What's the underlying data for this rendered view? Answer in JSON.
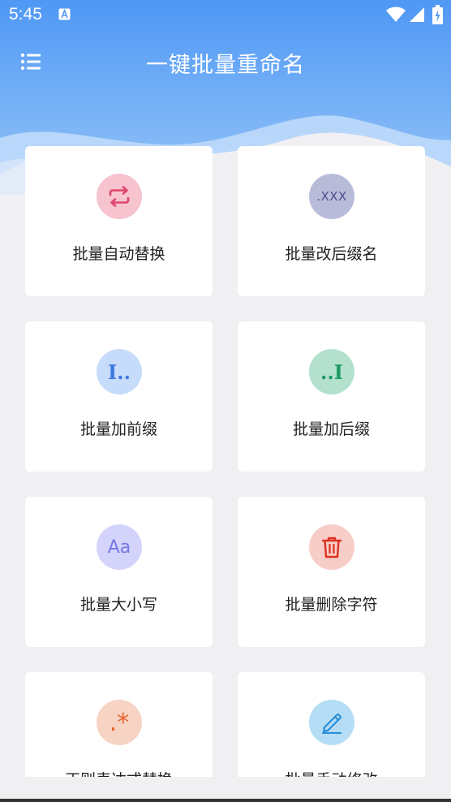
{
  "status_bar": {
    "time": "5:45",
    "notification_icon": "a-letter-icon"
  },
  "header": {
    "title": "一键批量重命名",
    "menu_icon": "menu-icon",
    "gradient": [
      "#4d94f0",
      "#b9d6fa"
    ]
  },
  "cards": [
    {
      "label": "批量自动替换",
      "icon": "swap-icon",
      "icon_bg": "#f6c3cf",
      "icon_color": "#e0466b"
    },
    {
      "label": "批量改后缀名",
      "icon": "extension-icon",
      "icon_text": ".XXX",
      "icon_bg": "#b9bcd9",
      "icon_color": "#4a4e8e"
    },
    {
      "label": "批量加前缀",
      "icon": "prefix-icon",
      "icon_text": "I..",
      "icon_bg": "#c6dcfa",
      "icon_color": "#3e78df"
    },
    {
      "label": "批量加后缀",
      "icon": "suffix-icon",
      "icon_text": "..I",
      "icon_bg": "#b3e1cd",
      "icon_color": "#1d9a63"
    },
    {
      "label": "批量大小写",
      "icon": "case-icon",
      "icon_text": "Aa",
      "icon_bg": "#d4d3fb",
      "icon_color": "#7778e4"
    },
    {
      "label": "批量删除字符",
      "icon": "trash-icon",
      "icon_bg": "#f7cdc8",
      "icon_color": "#df3020"
    },
    {
      "label": "正则表达式替换",
      "icon": "regex-icon",
      "icon_text": ".*",
      "icon_bg": "#f6d3c3",
      "icon_color": "#e4642e"
    },
    {
      "label": "批量手动修改",
      "icon": "pencil-icon",
      "icon_bg": "#b5ddf5",
      "icon_color": "#2b8fd6"
    }
  ]
}
